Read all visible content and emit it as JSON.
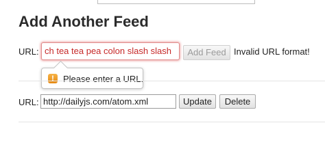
{
  "page": {
    "heading": "Add Another Feed"
  },
  "add_form": {
    "url_label": "URL:",
    "url_value": "ch tea tea pea colon slash slash",
    "add_button": "Add Feed",
    "validation_message": "Invalid URL format!"
  },
  "tooltip": {
    "icon": "warning-icon",
    "icon_glyph": "!",
    "text": "Please enter a URL."
  },
  "feeds": [
    {
      "url_label": "URL:",
      "url_value": "http://dailyjs.com/atom.xml",
      "update_button": "Update",
      "delete_button": "Delete"
    }
  ],
  "colors": {
    "invalid_border": "#e08c8c",
    "invalid_text": "#c62828",
    "warning_icon": "#f0a030"
  }
}
